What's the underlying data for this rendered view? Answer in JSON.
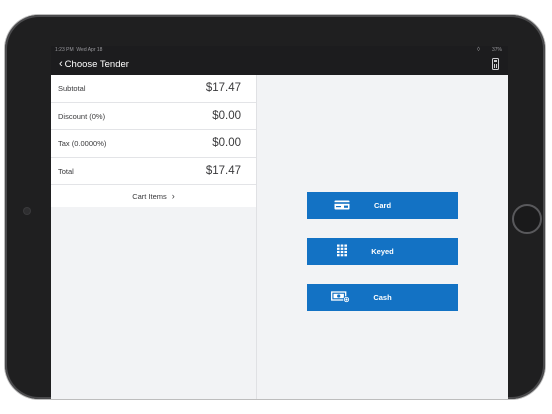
{
  "status_bar": {
    "time": "1:23 PM",
    "date": "Wed Apr 18",
    "battery": "37%"
  },
  "nav": {
    "back_label": "Choose Tender"
  },
  "summary": {
    "rows": [
      {
        "label": "Subtotal",
        "value": "$17.47"
      },
      {
        "label": "Discount (0%)",
        "value": "$0.00"
      },
      {
        "label": "Tax (0.0000%)",
        "value": "$0.00"
      },
      {
        "label": "Total",
        "value": "$17.47"
      }
    ],
    "cart_items_label": "Cart Items"
  },
  "tender_buttons": [
    {
      "label": "Card",
      "icon": "card-icon"
    },
    {
      "label": "Keyed",
      "icon": "keypad-icon"
    },
    {
      "label": "Cash",
      "icon": "cash-icon"
    }
  ],
  "colors": {
    "accent": "#1372c4",
    "navbar": "#1c1c1e",
    "background": "#f2f3f5"
  }
}
